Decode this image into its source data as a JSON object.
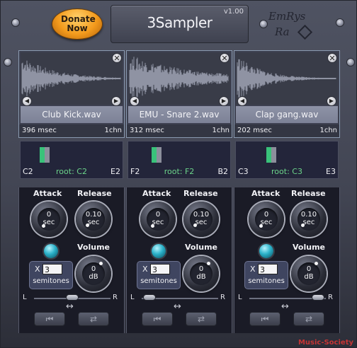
{
  "header": {
    "donate_label": "Donate Now",
    "title": "3Sampler",
    "version": "v1.00",
    "logo_line1": "EmRys",
    "logo_line2": "Ra"
  },
  "samples": [
    {
      "filename": "Club Kick.wav",
      "duration": "396 msec",
      "channels": "1chn",
      "key_low": "C2",
      "key_root": "root: C2",
      "key_high": "E2",
      "attack_value": "0",
      "attack_unit": "sec",
      "release_value": "0.10",
      "release_unit": "sec",
      "volume_value": "0",
      "volume_unit": "dB",
      "transpose_x": "X",
      "transpose_value": "3",
      "semitones_label": "semitones",
      "pan_left": "L",
      "pan_right": "R",
      "pan_value": 0.5
    },
    {
      "filename": "EMU - Snare 2.wav",
      "duration": "312 msec",
      "channels": "1chn",
      "key_low": "F2",
      "key_root": "root: F2",
      "key_high": "B2",
      "attack_value": "0",
      "attack_unit": "sec",
      "release_value": "0.10",
      "release_unit": "sec",
      "volume_value": "0",
      "volume_unit": "dB",
      "transpose_x": "X",
      "transpose_value": "3",
      "semitones_label": "semitones",
      "pan_left": "L",
      "pan_right": "R",
      "pan_value": 0.1
    },
    {
      "filename": "Clap gang.wav",
      "duration": "202 msec",
      "channels": "1chn",
      "key_low": "C3",
      "key_root": "root: C3",
      "key_high": "E3",
      "attack_value": "0",
      "attack_unit": "sec",
      "release_value": "0.10",
      "release_unit": "sec",
      "volume_value": "0",
      "volume_unit": "dB",
      "transpose_x": "X",
      "transpose_value": "3",
      "semitones_label": "semitones",
      "pan_left": "L",
      "pan_right": "R",
      "pan_value": 0.9
    }
  ],
  "labels": {
    "attack": "Attack",
    "release": "Release",
    "volume": "Volume"
  },
  "icons": {
    "close": "close-icon",
    "prev": "arrow-left-icon",
    "next": "arrow-right-icon",
    "skip_start": "skip-to-start-icon",
    "loop": "loop-icon",
    "double_arrow": "double-arrow-icon"
  },
  "watermark": "Music-Society",
  "colors": {
    "root_key": "#6cd48a",
    "donate": "#f39a1c",
    "led": "#2ab0c8"
  }
}
